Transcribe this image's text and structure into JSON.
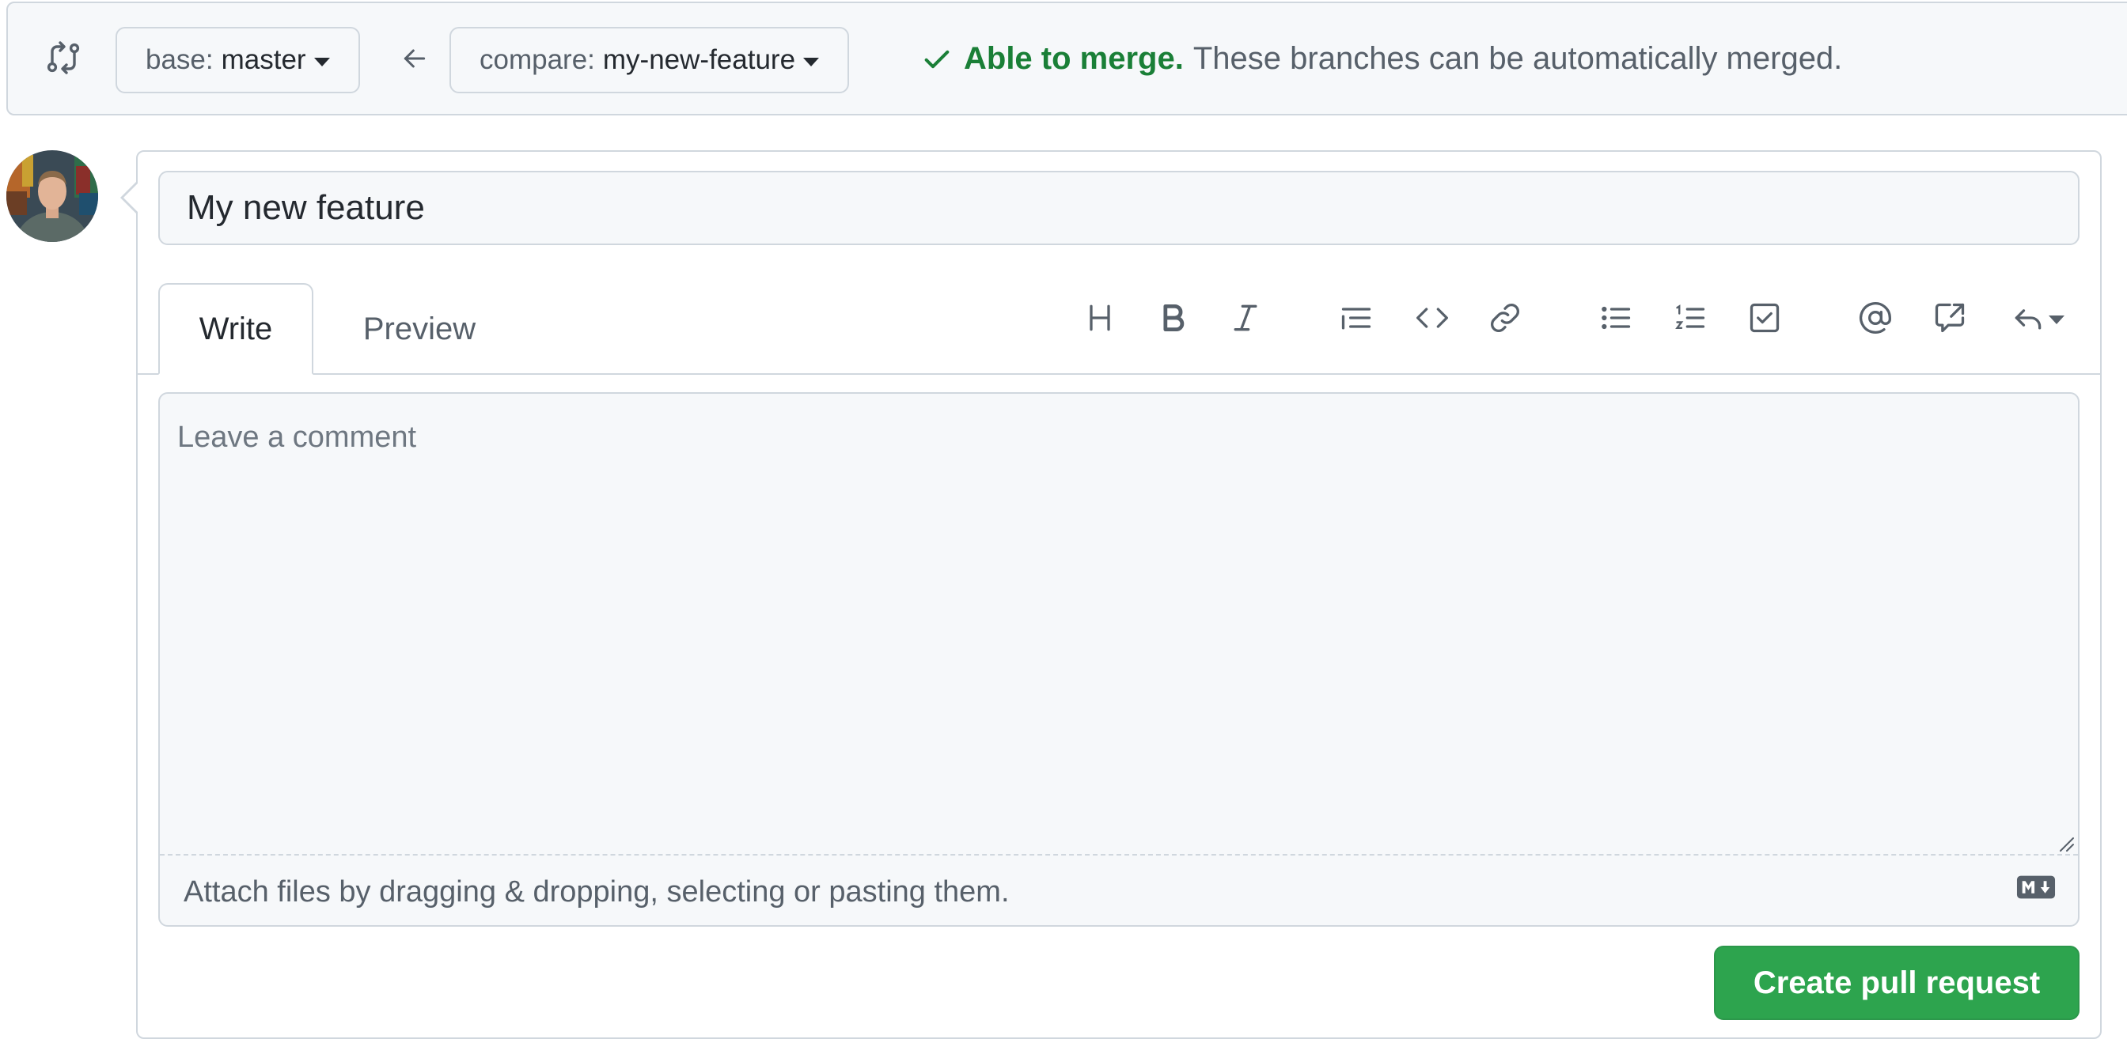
{
  "compare_bar": {
    "base_label": "base:",
    "base_branch": "master",
    "compare_label": "compare:",
    "compare_branch": "my-new-feature",
    "merge_status": "Able to merge.",
    "merge_description": "These branches can be automatically merged."
  },
  "form": {
    "title_value": "My new feature",
    "tabs": [
      {
        "label": "Write",
        "active": true
      },
      {
        "label": "Preview",
        "active": false
      }
    ],
    "toolbar_icons": [
      "heading-icon",
      "bold-icon",
      "italic-icon",
      "quote-icon",
      "code-icon",
      "link-icon",
      "unordered-list-icon",
      "ordered-list-icon",
      "task-list-icon",
      "mention-icon",
      "cross-reference-icon",
      "saved-reply-icon"
    ],
    "comment_placeholder": "Leave a comment",
    "attach_text": "Attach files by dragging & dropping, selecting or pasting them.",
    "submit_label": "Create pull request"
  },
  "colors": {
    "success": "#1a7f37",
    "button_green": "#2da44e",
    "border": "#d0d7de",
    "canvas_subtle": "#f6f8fa"
  }
}
